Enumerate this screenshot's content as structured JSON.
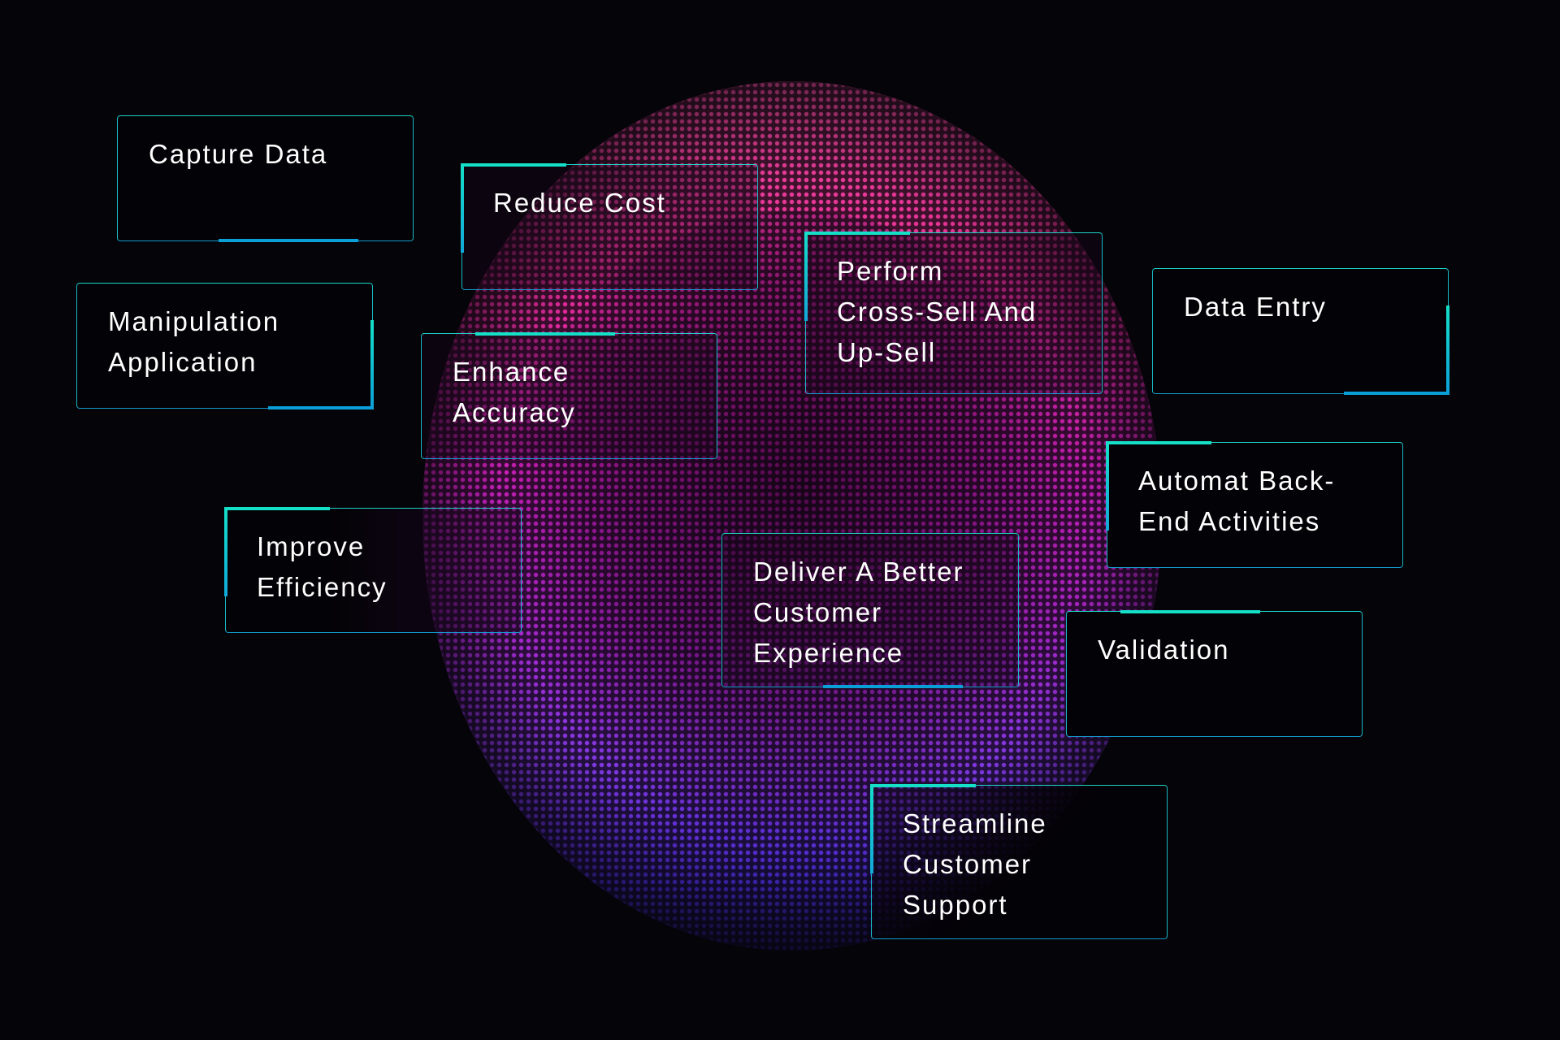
{
  "colors": {
    "background": "#050409",
    "card_border": "#18b9c4",
    "accent_teal": "#14e0c8",
    "accent_blue": "#0b9fd8",
    "sphere_top": "#ff4fa8",
    "sphere_mid": "#d823c4",
    "sphere_bottom": "#4a2bd0",
    "text": "#ffffff"
  },
  "graphic": {
    "name": "dotted-particle-sphere"
  },
  "cards": [
    {
      "id": "capture-data",
      "label": "Capture Data",
      "accent": "bottom-center"
    },
    {
      "id": "reduce-cost",
      "label": "Reduce Cost",
      "accent": "top-left-corner"
    },
    {
      "id": "perform-cross-sell",
      "label": "Perform\nCross-Sell And\nUp-Sell",
      "accent": "top-left-corner"
    },
    {
      "id": "data-entry",
      "label": "Data Entry",
      "accent": "bottom-right-corner"
    },
    {
      "id": "manipulation-application",
      "label": "Manipulation\nApplication",
      "accent": "bottom-right-corner"
    },
    {
      "id": "enhance-accuracy",
      "label": "Enhance\nAccuracy",
      "accent": "top-center"
    },
    {
      "id": "improve-efficiency",
      "label": "Improve\nEfficiency",
      "accent": "top-left-corner"
    },
    {
      "id": "deliver-customer-experience",
      "label": "Deliver A Better\nCustomer\nExperience",
      "accent": "bottom-center"
    },
    {
      "id": "automat-back-end",
      "label": "Automat Back-\nEnd Activities",
      "accent": "top-left-corner"
    },
    {
      "id": "validation",
      "label": "Validation",
      "accent": "top-center"
    },
    {
      "id": "streamline-customer-support",
      "label": "Streamline\nCustomer\nSupport",
      "accent": "top-left-corner"
    }
  ]
}
